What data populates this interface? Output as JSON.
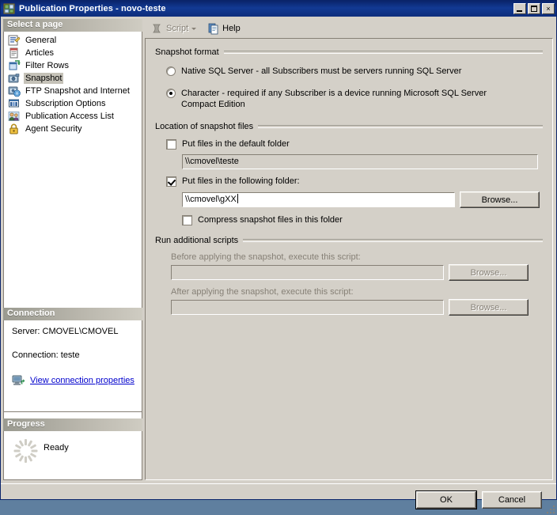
{
  "window": {
    "title": "Publication Properties - novo-teste",
    "icon": "publication-icon",
    "minimize_label": "Minimize",
    "maximize_label": "Maximize",
    "close_label": "Close",
    "close_glyph": "×"
  },
  "sidebar": {
    "header": "Select a page",
    "items": [
      {
        "label": "General",
        "icon": "general-page-icon",
        "selected": false
      },
      {
        "label": "Articles",
        "icon": "articles-page-icon",
        "selected": false
      },
      {
        "label": "Filter Rows",
        "icon": "filter-rows-page-icon",
        "selected": false
      },
      {
        "label": "Snapshot",
        "icon": "snapshot-page-icon",
        "selected": true
      },
      {
        "label": "FTP Snapshot and Internet",
        "icon": "ftp-snapshot-page-icon",
        "selected": false
      },
      {
        "label": "Subscription Options",
        "icon": "subscription-options-page-icon",
        "selected": false
      },
      {
        "label": "Publication Access List",
        "icon": "publication-access-list-page-icon",
        "selected": false
      },
      {
        "label": "Agent Security",
        "icon": "agent-security-page-icon",
        "selected": false
      }
    ]
  },
  "connection": {
    "header": "Connection",
    "server_line": "Server: CMOVEL\\CMOVEL",
    "connection_line": "Connection: teste",
    "link_label": "View connection properties",
    "link_icon": "server-connection-icon",
    "link_color": "#0000cc"
  },
  "progress": {
    "header": "Progress",
    "status": "Ready",
    "spinner_icon": "progress-spinner-icon"
  },
  "toolbar": {
    "script_label": "Script",
    "script_icon": "script-icon",
    "script_dropdown_icon": "chevron-down-icon",
    "script_disabled": true,
    "help_label": "Help",
    "help_icon": "help-icon"
  },
  "snapshot_format": {
    "group_title": "Snapshot format",
    "options": [
      {
        "label_prefix": "",
        "accesskey": "N",
        "label_rest": "ative SQL Server - all Subscribers must be servers running SQL Server",
        "full_label": "Native SQL Server - all Subscribers must be servers running SQL Server",
        "selected": false
      },
      {
        "label_prefix": "",
        "accesskey": "C",
        "label_rest": "haracter - required if any Subscriber is a device running Microsoft SQL Server Compact Edition",
        "full_label": "Character - required if any Subscriber is a device running Microsoft SQL Server Compact Edition",
        "selected": true
      }
    ]
  },
  "snapshot_location": {
    "group_title": "Location of snapshot files",
    "default_folder_check": {
      "label_pre": "P",
      "label_post": "ut files in the default folder",
      "full_label": "Put files in the default folder",
      "checked": false
    },
    "default_folder_value": "\\\\cmovel\\teste",
    "following_folder_check": {
      "label_pre": "Put f",
      "label_post": "iles in the following folder:",
      "full_label": "Put files in the following folder:",
      "checked": true
    },
    "following_folder_value": "\\\\cmovel\\gXX",
    "browse_label": "Browse...",
    "compress_check": {
      "label_pre": "Compress ",
      "label_post": "snapshot files in this folder",
      "full_label": "Compress snapshot files in this folder",
      "checked": false
    }
  },
  "additional_scripts": {
    "group_title": "Run additional scripts",
    "before_label": "Before applying the snapshot, execute this script:",
    "before_value": "",
    "before_browse_label": "Browse...",
    "after_label": "After applying the snapshot, execute this script:",
    "after_value": "",
    "after_browse_label": "Browse...",
    "disabled": true
  },
  "footer": {
    "ok_label": "OK",
    "cancel_label": "Cancel",
    "resize_grip_icon": "resize-grip-icon"
  }
}
